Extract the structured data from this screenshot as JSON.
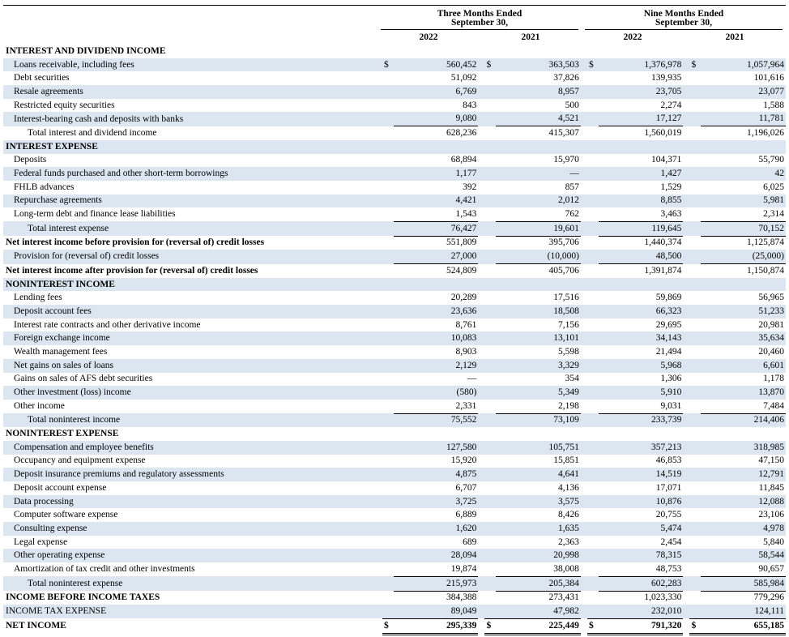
{
  "header": {
    "three_months": "Three Months Ended",
    "nine_months": "Nine Months Ended",
    "period_end": "September 30,",
    "years": [
      "2022",
      "2021",
      "2022",
      "2021"
    ]
  },
  "rows": [
    {
      "label": "INTEREST AND DIVIDEND INCOME",
      "type": "section",
      "values": []
    },
    {
      "label": "Loans receivable, including fees",
      "type": "item",
      "dollar": true,
      "values": [
        "560,452",
        "363,503",
        "1,376,978",
        "1,057,964"
      ]
    },
    {
      "label": "Debt securities",
      "type": "item",
      "values": [
        "51,092",
        "37,826",
        "139,935",
        "101,616"
      ]
    },
    {
      "label": "Resale agreements",
      "type": "item",
      "values": [
        "6,769",
        "8,957",
        "23,705",
        "23,077"
      ]
    },
    {
      "label": "Restricted equity securities",
      "type": "item",
      "values": [
        "843",
        "500",
        "2,274",
        "1,588"
      ]
    },
    {
      "label": "Interest-bearing cash and deposits with banks",
      "type": "item",
      "values": [
        "9,080",
        "4,521",
        "17,127",
        "11,781"
      ]
    },
    {
      "label": "Total interest and dividend income",
      "type": "total",
      "values": [
        "628,236",
        "415,307",
        "1,560,019",
        "1,196,026"
      ]
    },
    {
      "label": "INTEREST EXPENSE",
      "type": "section",
      "values": []
    },
    {
      "label": "Deposits",
      "type": "item",
      "values": [
        "68,894",
        "15,970",
        "104,371",
        "55,790"
      ]
    },
    {
      "label": "Federal funds purchased and other short-term borrowings",
      "type": "item",
      "values": [
        "1,177",
        "—",
        "1,427",
        "42"
      ]
    },
    {
      "label": "FHLB advances",
      "type": "item",
      "values": [
        "392",
        "857",
        "1,529",
        "6,025"
      ]
    },
    {
      "label": "Repurchase agreements",
      "type": "item",
      "values": [
        "4,421",
        "2,012",
        "8,855",
        "5,981"
      ]
    },
    {
      "label": "Long-term debt and finance lease liabilities",
      "type": "item",
      "values": [
        "1,543",
        "762",
        "3,463",
        "2,314"
      ]
    },
    {
      "label": "Total interest expense",
      "type": "total",
      "values": [
        "76,427",
        "19,601",
        "119,645",
        "70,152"
      ]
    },
    {
      "label": "Net interest income before provision for (reversal of) credit losses",
      "type": "bold",
      "line": true,
      "values": [
        "551,809",
        "395,706",
        "1,440,374",
        "1,125,874"
      ]
    },
    {
      "label": "Provision for (reversal of) credit losses",
      "type": "item",
      "values": [
        "27,000",
        "(10,000)",
        "48,500",
        "(25,000)"
      ]
    },
    {
      "label": "Net interest income after provision for (reversal of) credit losses",
      "type": "bold",
      "line": true,
      "values": [
        "524,809",
        "405,706",
        "1,391,874",
        "1,150,874"
      ]
    },
    {
      "label": "NONINTEREST INCOME",
      "type": "section",
      "values": []
    },
    {
      "label": "Lending fees",
      "type": "item",
      "values": [
        "20,289",
        "17,516",
        "59,869",
        "56,965"
      ]
    },
    {
      "label": "Deposit account fees",
      "type": "item",
      "values": [
        "23,636",
        "18,508",
        "66,323",
        "51,233"
      ]
    },
    {
      "label": "Interest rate contracts and other derivative income",
      "type": "item",
      "values": [
        "8,761",
        "7,156",
        "29,695",
        "20,981"
      ]
    },
    {
      "label": "Foreign exchange income",
      "type": "item",
      "values": [
        "10,083",
        "13,101",
        "34,143",
        "35,634"
      ]
    },
    {
      "label": "Wealth management fees",
      "type": "item",
      "values": [
        "8,903",
        "5,598",
        "21,494",
        "20,460"
      ]
    },
    {
      "label": "Net gains on sales of loans",
      "type": "item",
      "values": [
        "2,129",
        "3,329",
        "5,968",
        "6,601"
      ]
    },
    {
      "label": "Gains on sales of AFS debt securities",
      "type": "item",
      "values": [
        "—",
        "354",
        "1,306",
        "1,178"
      ]
    },
    {
      "label": "Other investment (loss) income",
      "type": "item",
      "values": [
        "(580)",
        "5,349",
        "5,910",
        "13,870"
      ]
    },
    {
      "label": "Other income",
      "type": "item",
      "values": [
        "2,331",
        "2,198",
        "9,031",
        "7,484"
      ]
    },
    {
      "label": "Total noninterest income",
      "type": "total",
      "values": [
        "75,552",
        "73,109",
        "233,739",
        "214,406"
      ]
    },
    {
      "label": "NONINTEREST EXPENSE",
      "type": "section",
      "values": []
    },
    {
      "label": "Compensation and employee benefits",
      "type": "item",
      "values": [
        "127,580",
        "105,751",
        "357,213",
        "318,985"
      ]
    },
    {
      "label": "Occupancy and equipment expense",
      "type": "item",
      "values": [
        "15,920",
        "15,851",
        "46,853",
        "47,150"
      ]
    },
    {
      "label": "Deposit insurance premiums and regulatory assessments",
      "type": "item",
      "values": [
        "4,875",
        "4,641",
        "14,519",
        "12,791"
      ]
    },
    {
      "label": "Deposit account expense",
      "type": "item",
      "values": [
        "6,707",
        "4,136",
        "17,071",
        "11,845"
      ]
    },
    {
      "label": "Data processing",
      "type": "item",
      "values": [
        "3,725",
        "3,575",
        "10,876",
        "12,088"
      ]
    },
    {
      "label": "Computer software expense",
      "type": "item",
      "values": [
        "6,889",
        "8,426",
        "20,755",
        "23,106"
      ]
    },
    {
      "label": "Consulting expense",
      "type": "item",
      "values": [
        "1,620",
        "1,635",
        "5,474",
        "4,978"
      ]
    },
    {
      "label": "Legal expense",
      "type": "item",
      "values": [
        "689",
        "2,363",
        "2,454",
        "5,840"
      ]
    },
    {
      "label": "Other operating expense",
      "type": "item",
      "values": [
        "28,094",
        "20,998",
        "78,315",
        "58,544"
      ]
    },
    {
      "label": "Amortization of tax credit and other investments",
      "type": "item",
      "values": [
        "19,874",
        "38,008",
        "48,753",
        "90,657"
      ]
    },
    {
      "label": "Total noninterest expense",
      "type": "total",
      "values": [
        "215,973",
        "205,384",
        "602,283",
        "585,984"
      ]
    },
    {
      "label": "INCOME BEFORE INCOME TAXES",
      "type": "bold",
      "line": true,
      "values": [
        "384,388",
        "273,431",
        "1,023,330",
        "779,296"
      ]
    },
    {
      "label": "INCOME TAX EXPENSE",
      "type": "item",
      "plainsec": true,
      "values": [
        "89,049",
        "47,982",
        "232,010",
        "124,111"
      ]
    },
    {
      "label": "NET INCOME",
      "type": "net",
      "dollar": true,
      "values": [
        "295,339",
        "225,449",
        "791,320",
        "655,185"
      ]
    }
  ],
  "dollar_sign": "$"
}
